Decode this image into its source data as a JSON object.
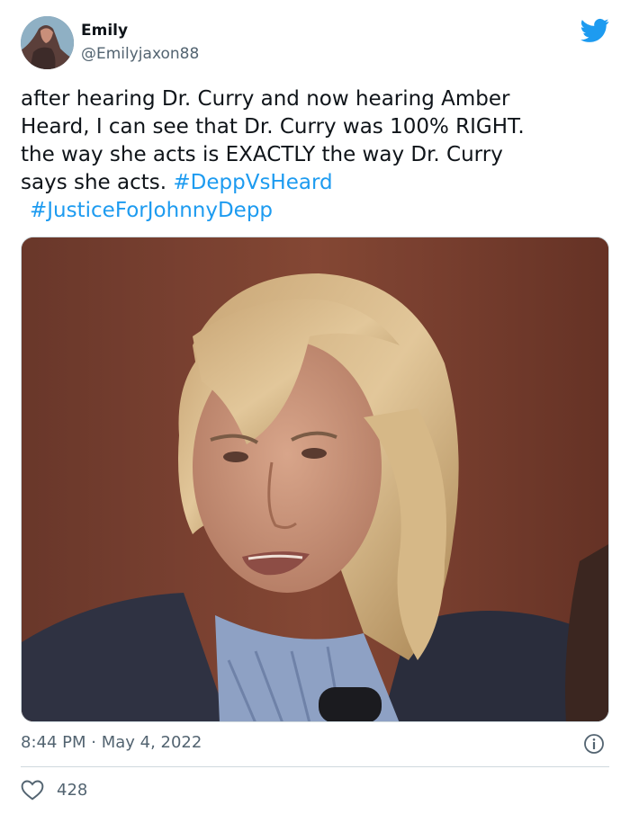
{
  "author": {
    "display_name": "Emily",
    "handle": "@Emilyjaxon88"
  },
  "tweet": {
    "lines": [
      "after hearing Dr. Curry and now hearing Amber",
      "Heard, I can see that Dr. Curry was 100% RIGHT.",
      "the way she acts is EXACTLY the way Dr. Curry",
      "says she acts. "
    ],
    "hashtags": [
      "#DeppVsHeard",
      "#JusticeForJohnnyDepp"
    ]
  },
  "meta": {
    "timestamp": "8:44 PM · May 4, 2022",
    "like_count": "428"
  },
  "colors": {
    "accent": "#1d9bf0",
    "secondary_text": "#536471",
    "divider": "#cfd9de"
  },
  "icons": {
    "brand": "twitter-bird-icon",
    "info": "info-icon",
    "like": "heart-icon"
  }
}
